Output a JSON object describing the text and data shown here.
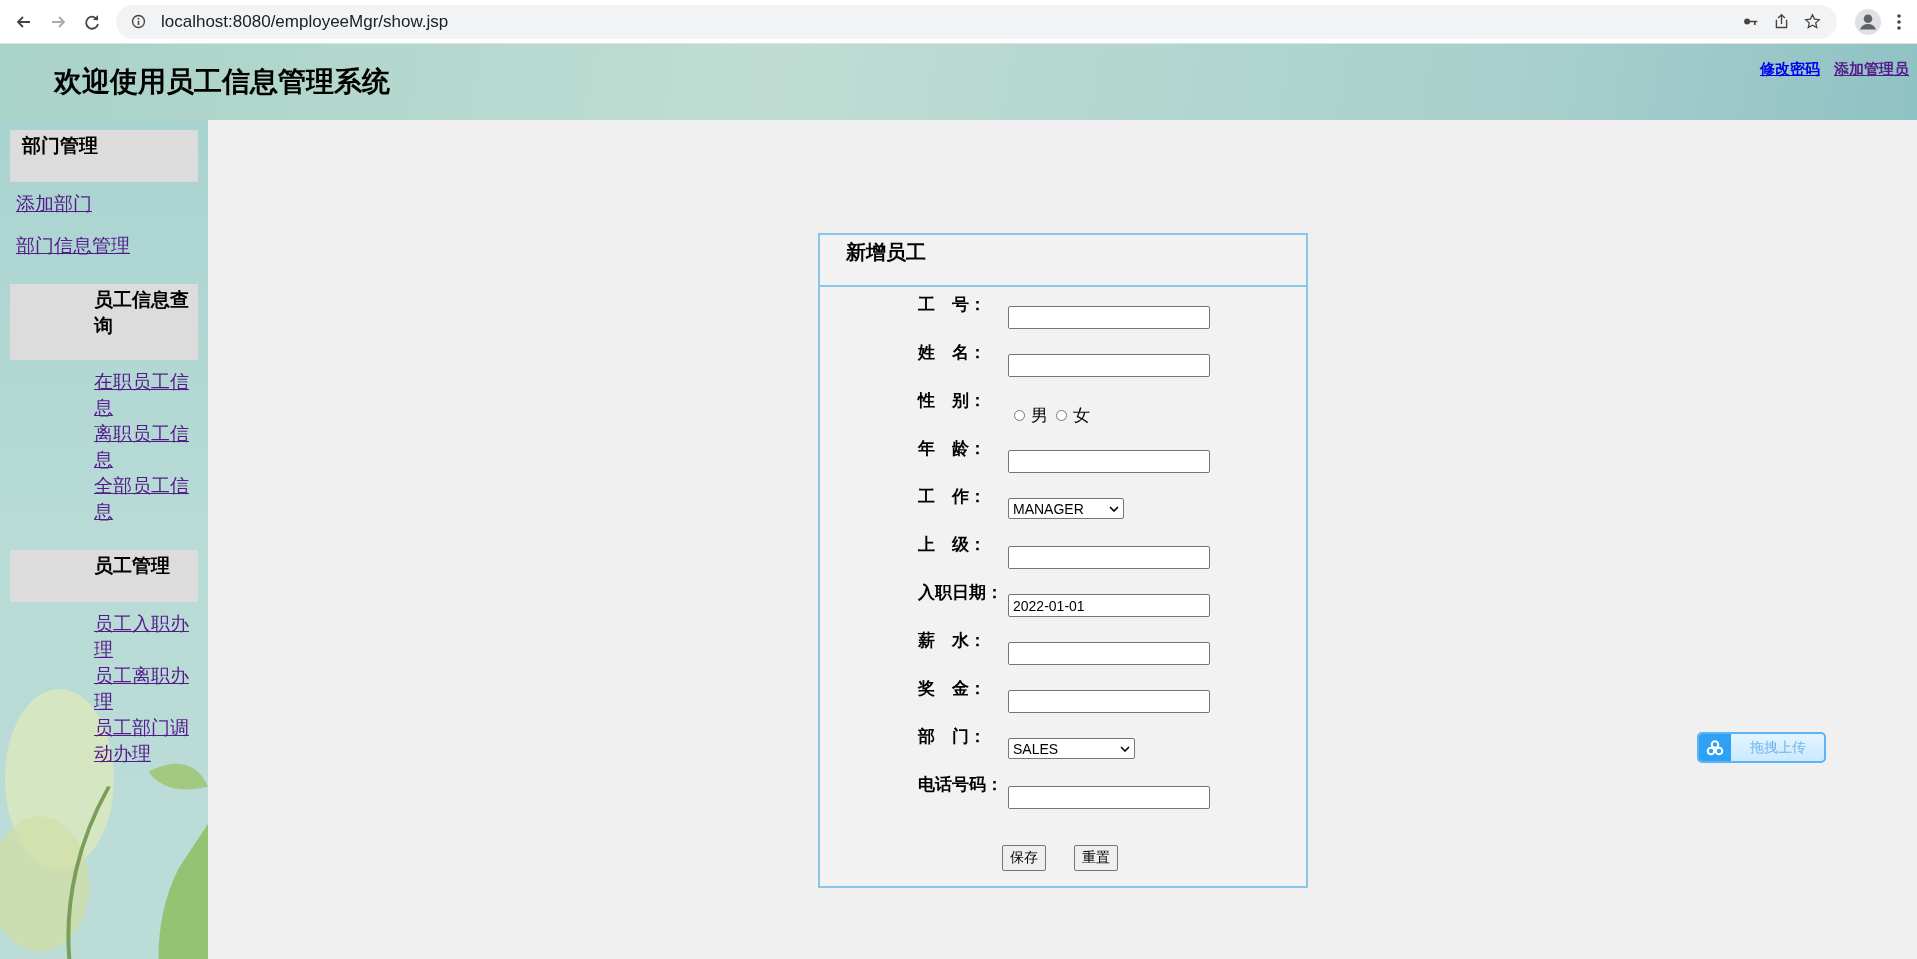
{
  "browser": {
    "url": "localhost:8080/employeeMgr/show.jsp",
    "forward_disabled": true
  },
  "header": {
    "title": "欢迎使用员工信息管理系统",
    "links": [
      {
        "label": "修改密码",
        "visited": false
      },
      {
        "label": "添加管理员",
        "visited": true
      }
    ]
  },
  "sidebar": {
    "sections": [
      {
        "title": "部门管理",
        "indented": false,
        "items": [
          "添加部门",
          "部门信息管理"
        ]
      },
      {
        "title": "员工信息查询",
        "indented": true,
        "items": [
          "在职员工信息",
          "离职员工信息",
          "全部员工信息"
        ]
      },
      {
        "title": "员工管理",
        "indented": true,
        "items": [
          "员工入职办理",
          "员工离职办理",
          "员工部门调动办理"
        ]
      }
    ]
  },
  "form": {
    "title": "新增员工",
    "fields": [
      {
        "label": "工　号：",
        "kind": "text"
      },
      {
        "label": "姓　名：",
        "kind": "text"
      },
      {
        "label": "性　别：",
        "kind": "radio",
        "options": [
          {
            "label": "男",
            "selected": false
          },
          {
            "label": "女",
            "selected": false
          }
        ]
      },
      {
        "label": "年　龄：",
        "kind": "text"
      },
      {
        "label": "工　作：",
        "kind": "select",
        "value": "MANAGER"
      },
      {
        "label": "上　级：",
        "kind": "text"
      },
      {
        "label": "入职日期：",
        "kind": "text",
        "value": "2022-01-01"
      },
      {
        "label": "薪　水：",
        "kind": "text"
      },
      {
        "label": "奖　金：",
        "kind": "text"
      },
      {
        "label": "部　门：",
        "kind": "select",
        "value": "SALES"
      },
      {
        "label": "电话号码：",
        "kind": "text"
      }
    ],
    "buttons": [
      "保存",
      "重置"
    ]
  },
  "upload_widget": {
    "label": "拖拽上传"
  }
}
